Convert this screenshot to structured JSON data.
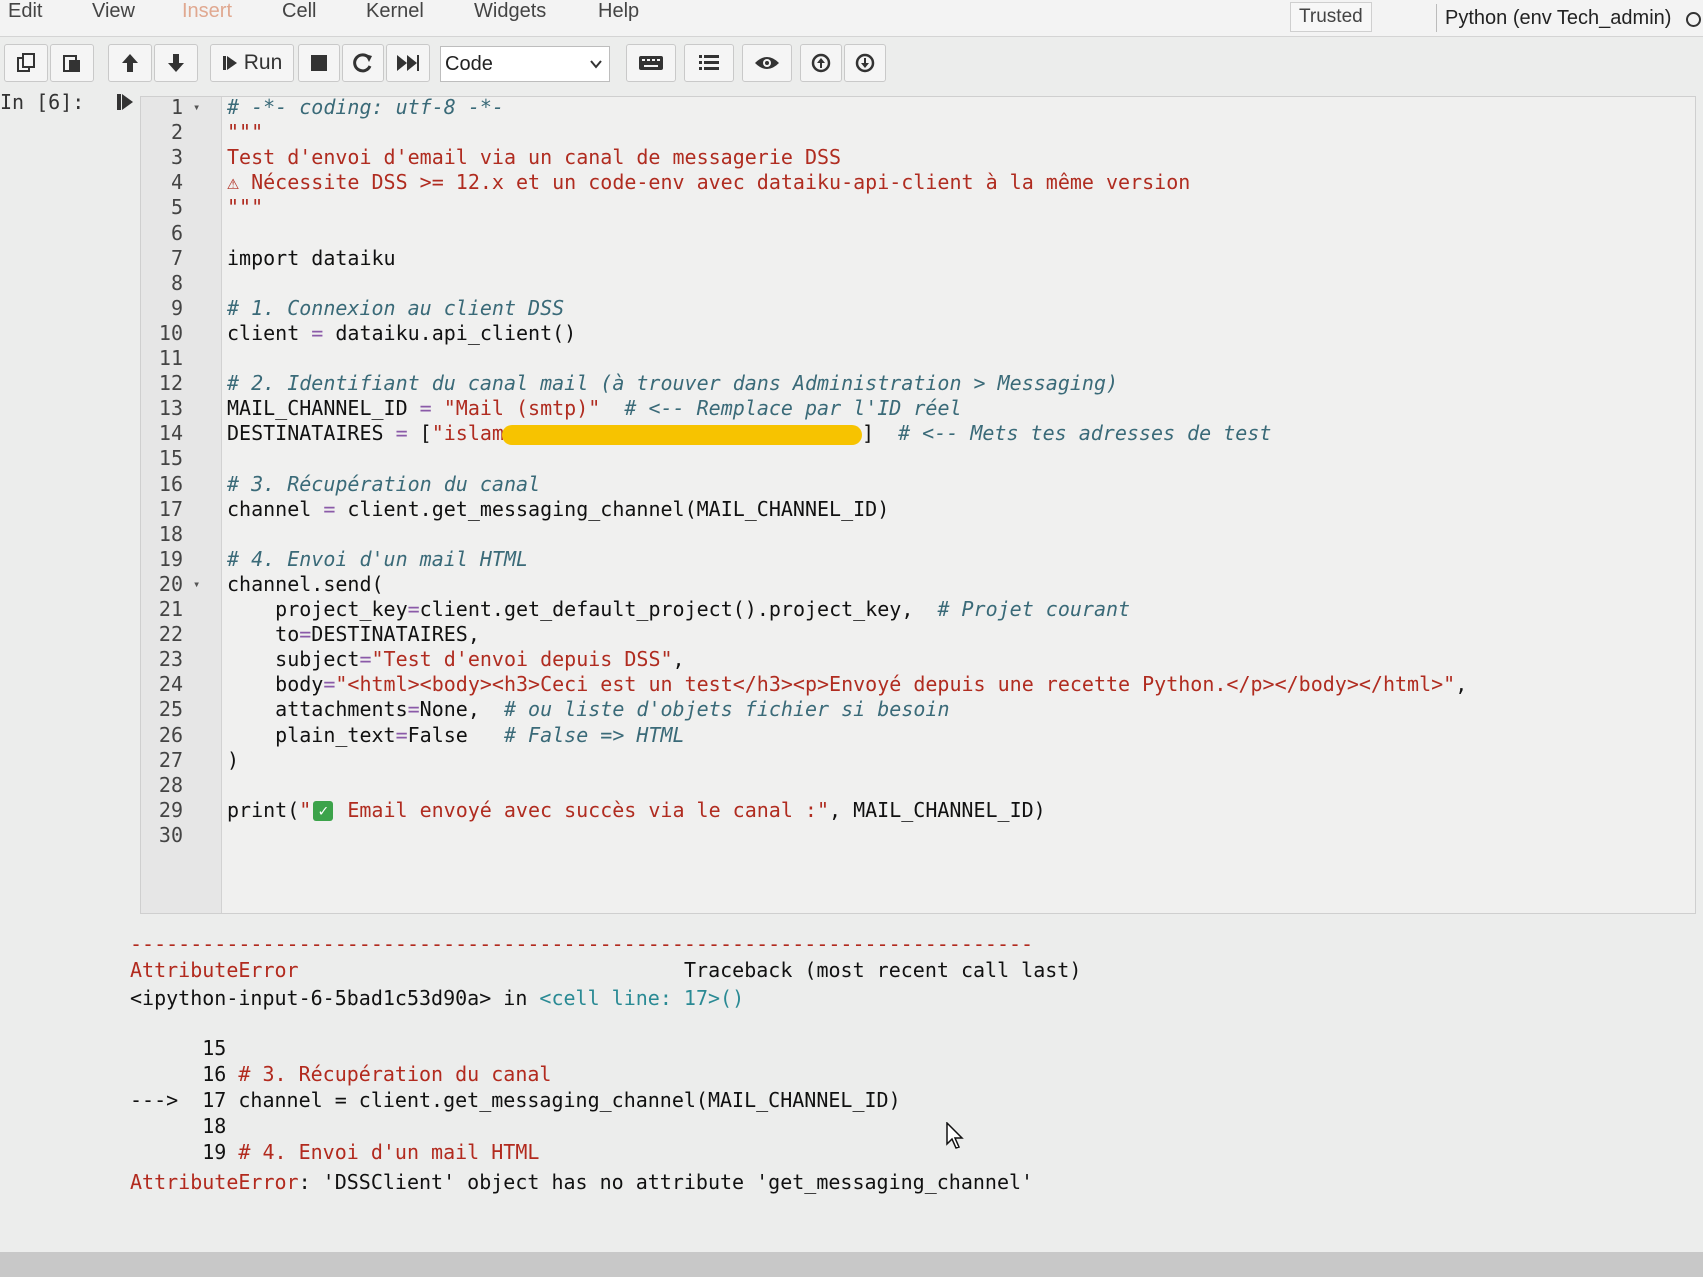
{
  "menubar": {
    "items": [
      "Edit",
      "View",
      "Insert",
      "Cell",
      "Kernel",
      "Widgets",
      "Help"
    ],
    "trusted": "Trusted",
    "kernel": "Python (env Tech_admin)"
  },
  "toolbar": {
    "run_label": "Run",
    "cell_type": "Code"
  },
  "cell": {
    "prompt": "In [6]:"
  },
  "code_lines": [
    "# -*- coding: utf-8 -*-",
    "\"\"\"",
    "Test d'envoi d'email via un canal de messagerie DSS",
    "⚠ Nécessite DSS >= 12.x et un code-env avec dataiku-api-client à la même version",
    "\"\"\"",
    "",
    "import dataiku",
    "",
    "# 1. Connexion au client DSS",
    "client = dataiku.api_client()",
    "",
    "# 2. Identifiant du canal mail (à trouver dans Administration > Messaging)",
    "MAIL_CHANNEL_ID = \"Mail (smtp)\"  # <-- Remplace par l'ID réel",
    "DESTINATAIRES = [\"islam",
    "",
    "# 3. Récupération du canal",
    "channel = client.get_messaging_channel(MAIL_CHANNEL_ID)",
    "",
    "# 4. Envoi d'un mail HTML",
    "channel.send(",
    "    project_key=client.get_default_project().project_key,  # Projet courant",
    "    to=DESTINATAIRES,",
    "    subject=\"Test d'envoi depuis DSS\",",
    "    body=\"<html><body><h3>Ceci est un test</h3><p>Envoyé depuis une recette Python.</p></body></html>\",",
    "    attachments=None,  # ou liste d'objets fichier si besoin",
    "    plain_text=False   # False => HTML",
    ")",
    "",
    "print(\"",
    ""
  ],
  "code_fragments": {
    "line14_tail": "]  # <-- Mets tes adresses de test",
    "line29_tail": " Email envoyé avec succès via le canal :\", MAIL_CHANNEL_ID)"
  },
  "output": {
    "divider": "---------------------------------------------------------------------------",
    "error_name": "AttributeError",
    "traceback_header": "Traceback (most recent call last)",
    "input_ref": "<ipython-input-6-5bad1c53d90a>",
    "in_word": " in ",
    "cell_line": "<cell line: 17>()",
    "tb_lines": [
      {
        "arrow": "     ",
        "num": "15",
        "text": ""
      },
      {
        "arrow": "     ",
        "num": "16",
        "text": "# 3. Récupération du canal"
      },
      {
        "arrow": "---> ",
        "num": "17",
        "text": "channel = client.get_messaging_channel(MAIL_CHANNEL_ID)"
      },
      {
        "arrow": "     ",
        "num": "18",
        "text": ""
      },
      {
        "arrow": "     ",
        "num": "19",
        "text": "# 4. Envoi d'un mail HTML"
      }
    ],
    "final_error_name": "AttributeError",
    "final_error_msg": ": 'DSSClient' object has no attribute 'get_messaging_channel'"
  }
}
